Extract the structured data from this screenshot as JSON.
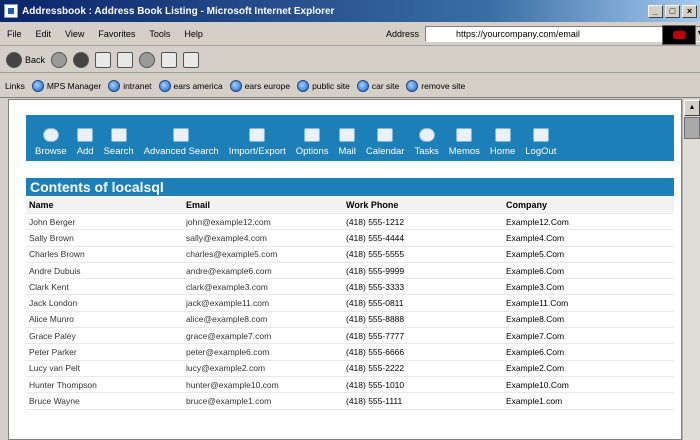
{
  "window": {
    "title": "Addressbook : Address Book Listing - Microsoft Internet Explorer"
  },
  "menubar": {
    "items": [
      "File",
      "Edit",
      "View",
      "Favorites",
      "Tools",
      "Help"
    ]
  },
  "address": {
    "label": "Address",
    "url": "https://yourcompany.com/email"
  },
  "toolbar": {
    "back_label": "Back"
  },
  "links": {
    "label": "Links",
    "items": [
      "MPS Manager",
      "intranet",
      "ears america",
      "ears europe",
      "public site",
      "car site",
      "remove site"
    ]
  },
  "nav": {
    "items": [
      "Browse",
      "Add",
      "Search",
      "Advanced Search",
      "Import/Export",
      "Options",
      "Mail",
      "Calendar",
      "Tasks",
      "Memos",
      "Home",
      "LogOut"
    ]
  },
  "content": {
    "heading": "Contents of localsql",
    "columns": [
      "Name",
      "Email",
      "Work Phone",
      "Company"
    ],
    "rows": [
      [
        "John Berger",
        "john@example12.com",
        "(418) 555-1212",
        "Example12.Com"
      ],
      [
        "Sally Brown",
        "sally@example4.com",
        "(418) 555-4444",
        "Example4.Com"
      ],
      [
        "Charles Brown",
        "charles@example5.com",
        "(418) 555-5555",
        "Example5.Com"
      ],
      [
        "Andre Dubuis",
        "andre@example6.com",
        "(418) 555-9999",
        "Example6.Com"
      ],
      [
        "Clark Kent",
        "clark@example3.com",
        "(418) 555-3333",
        "Example3.Com"
      ],
      [
        "Jack London",
        "jack@example11.com",
        "(418) 555-0811",
        "Example11.Com"
      ],
      [
        "Alice Munro",
        "alice@example8.com",
        "(418) 555-8888",
        "Example8.Com"
      ],
      [
        "Grace Paley",
        "grace@example7.com",
        "(418) 555-7777",
        "Example7.Com"
      ],
      [
        "Peter Parker",
        "peter@example6.com",
        "(418) 555-6666",
        "Example6.Com"
      ],
      [
        "Lucy van Pelt",
        "lucy@example2.com",
        "(418) 555-2222",
        "Example2.Com"
      ],
      [
        "Hunter Thompson",
        "hunter@example10.com",
        "(418) 555-1010",
        "Example10.Com"
      ],
      [
        "Bruce Wayne",
        "bruce@example1.com",
        "(418) 555-1111",
        "Example1.com"
      ]
    ]
  }
}
